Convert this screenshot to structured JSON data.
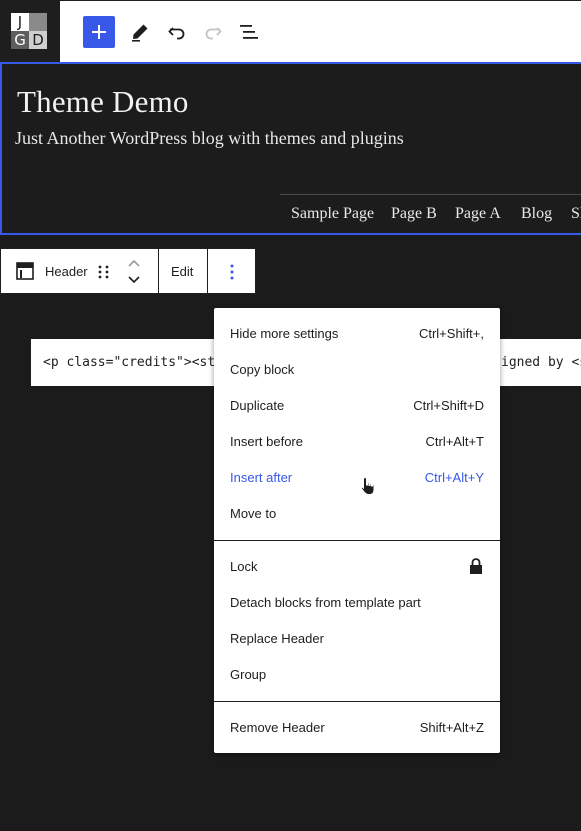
{
  "logo": {
    "letters": [
      "J",
      "",
      "G",
      "D"
    ]
  },
  "toolbar": {
    "add_icon": "plus-icon",
    "tools_icon": "pencil-icon",
    "undo_icon": "undo-icon",
    "redo_icon": "redo-icon",
    "outline_icon": "list-view-icon",
    "accent_color": "#3858e9"
  },
  "site": {
    "title": "Theme Demo",
    "tagline": "Just Another WordPress blog with themes and plugins",
    "nav": [
      "Sample Page",
      "Page B",
      "Page A",
      "Blog",
      "Sh"
    ]
  },
  "block_toolbar": {
    "block_icon": "template-part-icon",
    "label": "Header",
    "drag_icon": "drag-handle-icon",
    "move_up_icon": "chevron-up-icon",
    "move_down_icon": "chevron-down-icon",
    "edit_label": "Edit",
    "options_icon": "more-vertical-icon"
  },
  "code_preview": {
    "left_text": "<p class=\"credits\"><st",
    "right_text": "igned by <s"
  },
  "menu": {
    "group1": [
      {
        "label": "Hide more settings",
        "shortcut": "Ctrl+Shift+,"
      },
      {
        "label": "Copy block",
        "shortcut": ""
      },
      {
        "label": "Duplicate",
        "shortcut": "Ctrl+Shift+D"
      },
      {
        "label": "Insert before",
        "shortcut": "Ctrl+Alt+T"
      },
      {
        "label": "Insert after",
        "shortcut": "Ctrl+Alt+Y"
      },
      {
        "label": "Move to",
        "shortcut": ""
      }
    ],
    "group2": [
      {
        "label": "Lock",
        "icon": "lock-icon"
      },
      {
        "label": "Detach blocks from template part"
      },
      {
        "label": "Replace Header"
      },
      {
        "label": "Group"
      }
    ],
    "group3": [
      {
        "label": "Remove Header",
        "shortcut": "Shift+Alt+Z"
      }
    ]
  }
}
